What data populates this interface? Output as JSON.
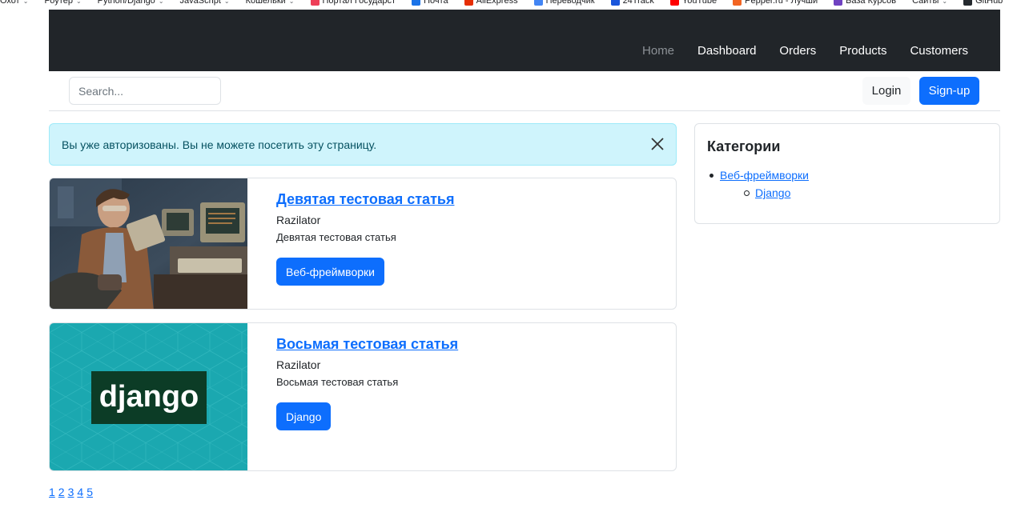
{
  "bookmarks": [
    {
      "label": "Охот",
      "icon": "folder-icon",
      "color": "#5f6368"
    },
    {
      "label": "Роутер",
      "icon": "folder-icon",
      "color": "#5f6368"
    },
    {
      "label": "Python/Django",
      "icon": "folder-icon",
      "color": "#5f6368"
    },
    {
      "label": "JavaScript",
      "icon": "folder-icon",
      "color": "#5f6368"
    },
    {
      "label": "Кошельки",
      "icon": "folder-icon",
      "color": "#5f6368"
    },
    {
      "label": "Портал Государст",
      "icon": "gosuslugi-icon",
      "color": "#ee3f58"
    },
    {
      "label": "Почта",
      "icon": "mail-icon",
      "color": "#1a73e8"
    },
    {
      "label": "AliExpress",
      "icon": "aliexpress-icon",
      "color": "#e62e04"
    },
    {
      "label": "Переводчик",
      "icon": "translate-icon",
      "color": "#4285f4"
    },
    {
      "label": "24Track",
      "icon": "track-icon",
      "color": "#1a56db"
    },
    {
      "label": "YouTube",
      "icon": "youtube-icon",
      "color": "#ff0000"
    },
    {
      "label": "Pepper.ru - Лучши",
      "icon": "pepper-icon",
      "color": "#f26522"
    },
    {
      "label": "База Курсов",
      "icon": "courses-icon",
      "color": "#6f42c1"
    },
    {
      "label": "Сайты",
      "icon": "folder-icon",
      "color": "#5f6368"
    },
    {
      "label": "GitHub",
      "icon": "github-icon",
      "color": "#24292e"
    }
  ],
  "navbar": {
    "links": [
      {
        "label": "Home",
        "active": false
      },
      {
        "label": "Dashboard",
        "active": true
      },
      {
        "label": "Orders",
        "active": true
      },
      {
        "label": "Products",
        "active": true
      },
      {
        "label": "Customers",
        "active": true
      }
    ]
  },
  "toolbar": {
    "search_placeholder": "Search...",
    "login_label": "Login",
    "signup_label": "Sign-up"
  },
  "alert": {
    "text": "Вы уже авторизованы. Вы не можете посетить эту страницу."
  },
  "articles": [
    {
      "title": "Девятая тестовая статья",
      "author": "Razilator",
      "description": "Девятая тестовая статья",
      "category_button": "Веб-фреймворки"
    },
    {
      "title": "Восьмая тестовая статья",
      "author": "Razilator",
      "description": "Восьмая тестовая статья",
      "category_button": "Django",
      "image_logo_text": "django"
    }
  ],
  "sidebar": {
    "title": "Категории",
    "category": "Веб-фреймворки",
    "subcategory": "Django"
  },
  "pagination": [
    "1",
    "2",
    "3",
    "4",
    "5"
  ],
  "colors": {
    "primary": "#0d6efd",
    "navbar_bg": "#212529",
    "alert_bg": "#cff4fc",
    "alert_text": "#055160",
    "django_teal": "#1ba8b0",
    "django_dark": "#0c3c26"
  }
}
